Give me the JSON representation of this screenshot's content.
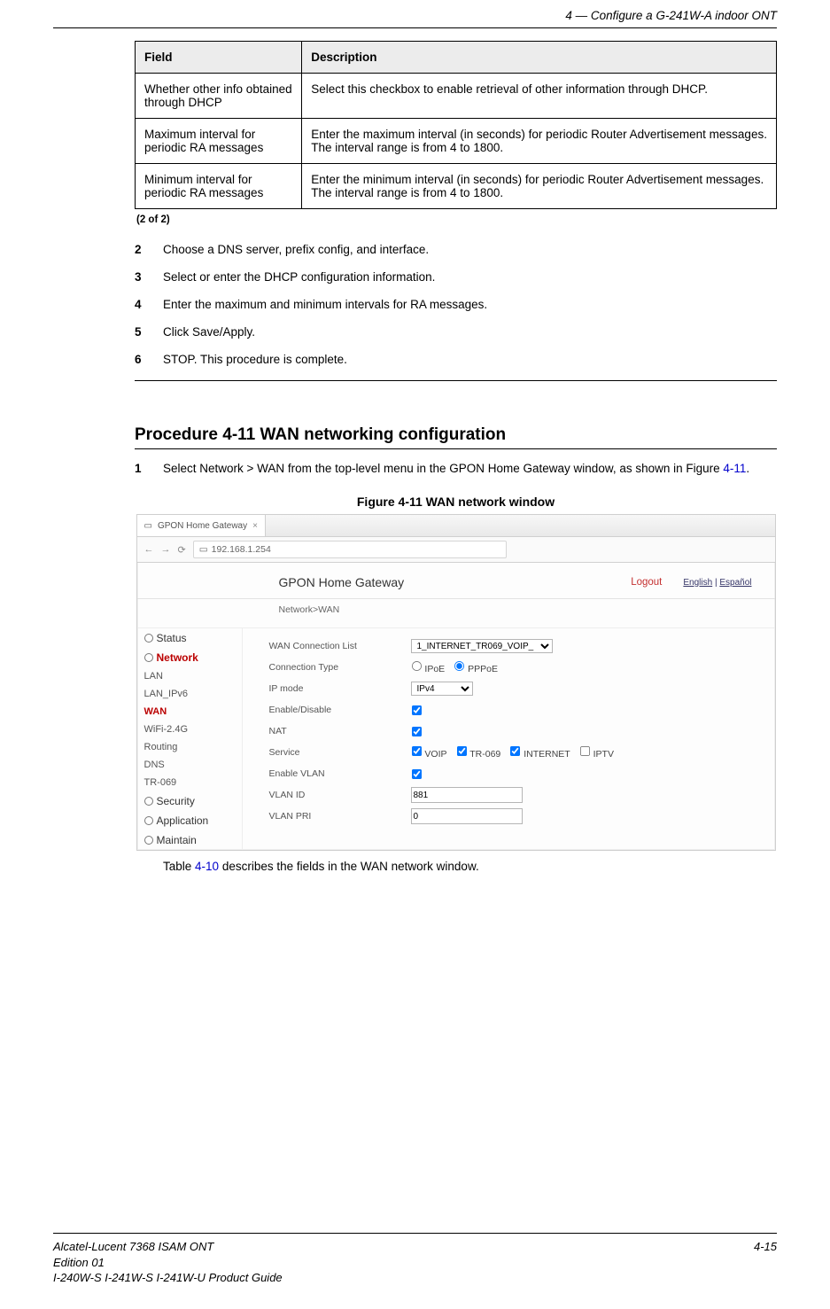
{
  "header": {
    "chapter_label": "4 —  Configure a G-241W-A indoor ONT"
  },
  "table": {
    "columns": [
      "Field",
      "Description"
    ],
    "rows": [
      {
        "field": "Whether other info obtained through DHCP",
        "desc": "Select this checkbox to enable retrieval of other information through DHCP."
      },
      {
        "field": "Maximum interval for periodic RA messages",
        "desc": "Enter the maximum interval (in seconds) for periodic Router Advertisement messages. The interval range is from 4 to 1800."
      },
      {
        "field": "Minimum interval for periodic RA messages",
        "desc": "Enter the minimum interval (in seconds) for periodic Router Advertisement messages. The interval range is from 4 to 1800."
      }
    ],
    "caption": "(2 of 2)"
  },
  "steps_a": [
    {
      "n": "2",
      "t": "Choose a DNS server, prefix config, and interface."
    },
    {
      "n": "3",
      "t": "Select or enter the DHCP configuration information."
    },
    {
      "n": "4",
      "t": "Enter the maximum and minimum intervals for RA messages."
    },
    {
      "n": "5",
      "t": "Click Save/Apply."
    },
    {
      "n": "6",
      "t": "STOP. This procedure is complete."
    }
  ],
  "procedure": {
    "title": "Procedure 4-11  WAN networking configuration",
    "step1_prefix": "Select Network > WAN from the top-level menu in the GPON Home Gateway window, as shown in Figure ",
    "step1_link": "4-11",
    "step1_suffix": "."
  },
  "figure_title": "Figure 4-11  WAN network window",
  "browser": {
    "tab_title": "GPON Home Gateway",
    "url": "192.168.1.254",
    "app_title": "GPON Home Gateway",
    "logout": "Logout",
    "lang_en": "English",
    "lang_es": "Español",
    "breadcrumb": "Network>WAN",
    "nav": {
      "status": "Status",
      "network": "Network",
      "lan": "LAN",
      "lan_ipv6": "LAN_IPv6",
      "wan": "WAN",
      "wifi": "WiFi-2.4G",
      "routing": "Routing",
      "dns": "DNS",
      "tr069": "TR-069",
      "security": "Security",
      "application": "Application",
      "maintain": "Maintain"
    },
    "form": {
      "wan_conn_list_label": "WAN Connection List",
      "wan_conn_list_value": "1_INTERNET_TR069_VOIP_",
      "conn_type_label": "Connection Type",
      "ipoe": "IPoE",
      "pppoe": "PPPoE",
      "ip_mode_label": "IP mode",
      "ip_mode_value": "IPv4",
      "enable_label": "Enable/Disable",
      "nat_label": "NAT",
      "service_label": "Service",
      "svc_voip": "VOIP",
      "svc_tr069": "TR-069",
      "svc_internet": "INTERNET",
      "svc_iptv": "IPTV",
      "enable_vlan_label": "Enable VLAN",
      "vlan_id_label": "VLAN ID",
      "vlan_id_value": "881",
      "vlan_pri_label": "VLAN PRI",
      "vlan_pri_value": "0"
    }
  },
  "after_figure_prefix": "Table ",
  "after_figure_link": "4-10",
  "after_figure_suffix": " describes the fields in the WAN network window.",
  "footer": {
    "l1": "Alcatel-Lucent 7368 ISAM ONT",
    "l2": "Edition 01",
    "l3": "I-240W-S I-241W-S I-241W-U Product Guide",
    "page": "4-15"
  }
}
